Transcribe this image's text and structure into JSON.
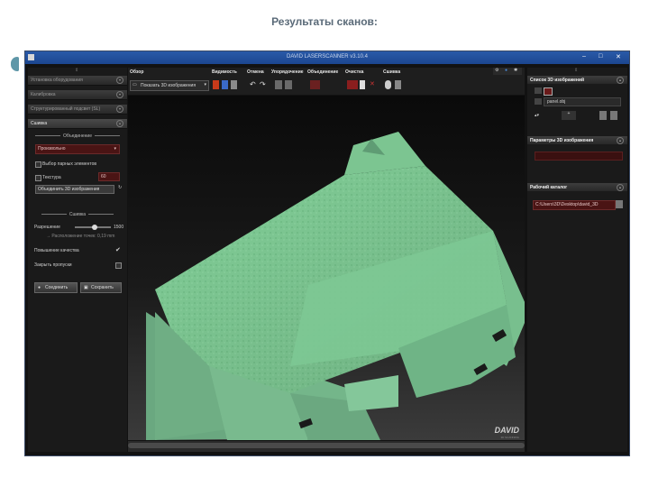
{
  "slide": {
    "title": "Результаты сканов:"
  },
  "window": {
    "title": "DAVID LASERSCANNER v3.10.4",
    "min": "–",
    "max": "□",
    "close": "✕"
  },
  "left_panel": {
    "sections": [
      {
        "label": "Установка оборудования"
      },
      {
        "label": "Калибровка"
      },
      {
        "label": "Структурированный подсвет (SL)"
      },
      {
        "label": "Сшивка"
      }
    ],
    "combine_header": "Объединение",
    "combine_mode": "Произвольно",
    "pair_select": "Выбор парных элементов",
    "texture_label": "Текстура",
    "texture_value": "60",
    "combine_button": "Объединить 3D изображения",
    "stitch_header": "Сшивка",
    "resolution_label": "Разрешение",
    "resolution_value": "1500",
    "resolution_level": 0.55,
    "spacing_text": "→ Расположение точек: 0,19 mm",
    "quality_label": "Повышение качества",
    "quality_checked": "✔",
    "close_holes_label": "Закрыть пропуски",
    "merge_button": "Соединить",
    "save_button": "Сохранить"
  },
  "toolbar": {
    "groups": [
      "Обзор",
      "Видимость",
      "Отмена",
      "Упорядочение",
      "Объединение",
      "Очистка",
      "Сшивка"
    ],
    "show_3d": "Показать 3D изображения"
  },
  "right_panel": {
    "list_title": "Список 3D изображений",
    "list_item": "panel.obj",
    "params_title": "Параметры 3D изображения",
    "catalog_title": "Рабочий каталог",
    "catalog_path": "C:\\Users\\3D\\Desktop\\david_3D"
  },
  "watermark": {
    "logo": "DAVID",
    "tagline": "3D SCANNING"
  },
  "colors": {
    "mesh": "#7fd09a",
    "accent": "#8a1e1e",
    "titlebar": "#2a5aa8"
  }
}
